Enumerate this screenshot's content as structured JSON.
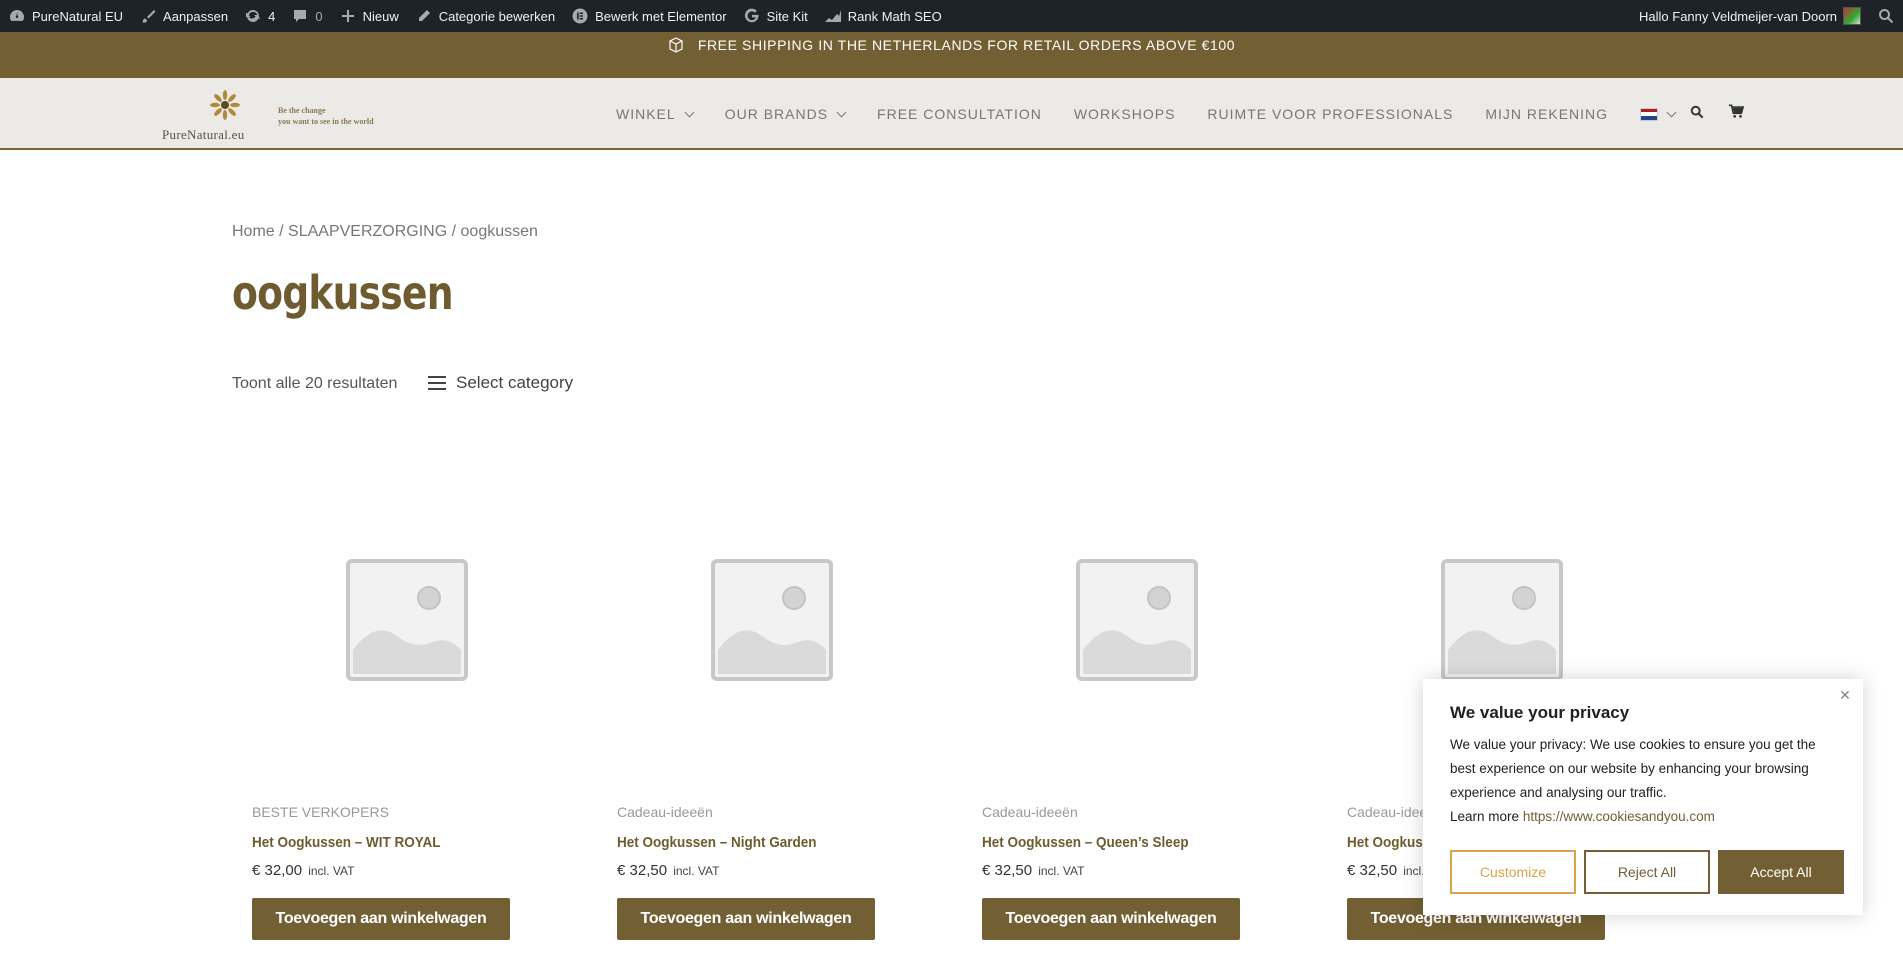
{
  "adminbar": {
    "site": "PureNatural EU",
    "customize": "Aanpassen",
    "updates": "4",
    "comments": "0",
    "new": "Nieuw",
    "edit_category": "Categorie bewerken",
    "elementor": "Bewerk met Elementor",
    "sitekit": "Site Kit",
    "rankmath": "Rank Math SEO",
    "greeting": "Hallo Fanny Veldmeijer-van Doorn"
  },
  "notice": {
    "text": "FREE SHIPPING IN THE NETHERLANDS FOR RETAIL ORDERS ABOVE €100"
  },
  "header": {
    "logo_name": "PureNatural.eu",
    "tagline_1": "Be the change",
    "tagline_2": "you want to see in the world",
    "nav": [
      "WINKEL",
      "OUR BRANDS",
      "FREE CONSULTATION",
      "WORKSHOPS",
      "RUIMTE VOOR PROFESSIONALS",
      "MIJN REKENING"
    ]
  },
  "breadcrumb": {
    "home": "Home",
    "sep": " / ",
    "cat": "SLAAPVERZORGING",
    "current": "oogkussen"
  },
  "page": {
    "title": "oogkussen",
    "result_count": "Toont alle 20 resultaten",
    "select_category": "Select category"
  },
  "products": [
    {
      "category": "BESTE VERKOPERS",
      "name": "Het Oogkussen – WIT ROYAL",
      "price": "€ 32,00",
      "tax": "incl. VAT",
      "button": "Toevoegen aan winkelwagen"
    },
    {
      "category": "Cadeau-ideeën",
      "name": "Het Oogkussen – Night Garden",
      "price": "€ 32,50",
      "tax": "incl. VAT",
      "button": "Toevoegen aan winkelwagen"
    },
    {
      "category": "Cadeau-ideeën",
      "name": "Het Oogkussen – Queen’s Sleep",
      "price": "€ 32,50",
      "tax": "incl. VAT",
      "button": "Toevoegen aan winkelwagen"
    },
    {
      "category": "Cadeau-ideeën",
      "name": "Het Oogkussen",
      "price": "€ 32,50",
      "tax": "incl.",
      "button": "Toevoegen aan winkelwagen"
    }
  ],
  "cookie": {
    "title": "We value your privacy",
    "body": "We value your privacy: We use cookies to ensure you get the best experience on our website by enhancing your browsing experience and analysing our traffic.",
    "learn_more": "Learn more",
    "link": "https://www.cookiesandyou.com",
    "customize": "Customize",
    "reject": "Reject All",
    "accept": "Accept All"
  },
  "colors": {
    "brand": "#725f33",
    "adminbar": "#1d2327",
    "header_bg": "#eceae6"
  }
}
